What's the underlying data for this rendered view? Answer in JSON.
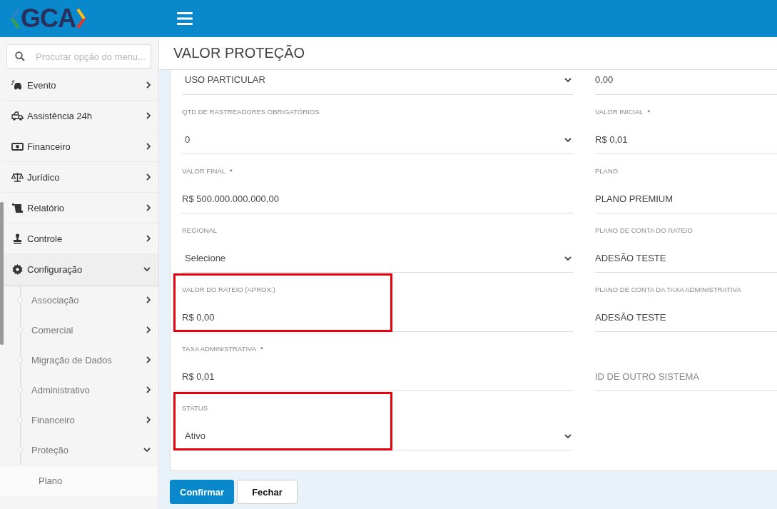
{
  "header": {
    "logo": "GCA"
  },
  "sidebar": {
    "search": {
      "placeholder": "Procurar opção do menu..."
    },
    "items": [
      {
        "label": "Evento",
        "expanded": false
      },
      {
        "label": "Assistência 24h",
        "expanded": false
      },
      {
        "label": "Financeiro",
        "expanded": false
      },
      {
        "label": "Jurídico",
        "expanded": false
      },
      {
        "label": "Relatório",
        "expanded": false
      },
      {
        "label": "Controle",
        "expanded": false
      },
      {
        "label": "Configuração",
        "expanded": true,
        "children": [
          {
            "label": "Associação",
            "expanded": false
          },
          {
            "label": "Comercial",
            "expanded": false
          },
          {
            "label": "Migração de Dados",
            "expanded": false
          },
          {
            "label": "Administrativo",
            "expanded": false
          },
          {
            "label": "Financeiro",
            "expanded": false
          },
          {
            "label": "Proteção",
            "expanded": true,
            "children": [
              {
                "label": "Plano",
                "selected": false
              }
            ]
          }
        ]
      }
    ]
  },
  "page": {
    "title": "VALOR PROTEÇÃO"
  },
  "form": {
    "rows": [
      [
        {
          "kind": "select",
          "value": "USO PARTICULAR"
        },
        {
          "kind": "input",
          "value": "0,00"
        }
      ],
      [
        {
          "kind": "select",
          "label": "QTD DE RASTREADORES OBRIGATÓRIOS",
          "value": "0"
        },
        {
          "kind": "input",
          "label": "VALOR INICIAL",
          "required_mark": "*",
          "value": "R$ 0,01"
        }
      ],
      [
        {
          "kind": "input",
          "label": "VALOR FINAL",
          "required_mark": "*",
          "value": "R$ 500.000.000.000,00"
        },
        {
          "kind": "input",
          "label": "PLANO",
          "value": "PLANO PREMIUM"
        }
      ],
      [
        {
          "kind": "select",
          "label": "REGIONAL",
          "value": "Selecione"
        },
        {
          "kind": "input",
          "label": "PLANO DE CONTA DO RATEIO",
          "value": "ADESÃO TESTE"
        }
      ],
      [
        {
          "kind": "input",
          "label": "VALOR DO RATEIO (APROX.)",
          "value": "R$ 0,00",
          "highlighted": true
        },
        {
          "kind": "input",
          "label": "PLANO DE CONTA DA TAXA ADMINISTRATIVA",
          "value": "ADESÃO TESTE"
        }
      ],
      [
        {
          "kind": "input",
          "label": "TAXA ADMINISTRATIVA",
          "required_mark": "*",
          "value": "R$ 0,01"
        },
        {
          "kind": "input",
          "placeholder": "ID DE OUTRO SISTEMA"
        }
      ],
      [
        {
          "kind": "select",
          "label": "STATUS",
          "value": "Ativo",
          "highlighted": true
        }
      ]
    ]
  },
  "buttons": [
    {
      "label": "Confirmar",
      "kind": "primary"
    },
    {
      "label": "Fechar",
      "kind": "default"
    }
  ]
}
